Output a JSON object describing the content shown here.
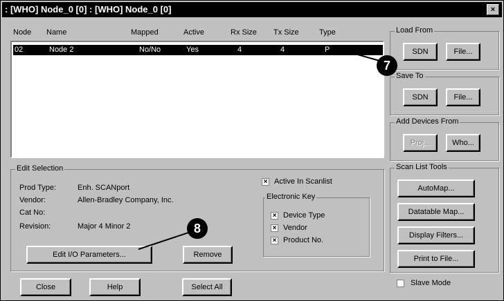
{
  "window": {
    "title": ": [WHO] Node_0 [0] : [WHO] Node_0 [0]",
    "close": "×"
  },
  "columns": [
    "Node",
    "Name",
    "Mapped",
    "Active",
    "Rx Size",
    "Tx Size",
    "Type"
  ],
  "rows": [
    {
      "node": "02",
      "name": "Node 2",
      "mapped": "No/No",
      "active": "Yes",
      "rx": "4",
      "tx": "4",
      "type": "P"
    }
  ],
  "load_from": {
    "title": "Load From",
    "sdn": "SDN",
    "file": "File..."
  },
  "save_to": {
    "title": "Save To",
    "sdn": "SDN",
    "file": "File..."
  },
  "add_devices": {
    "title": "Add Devices From",
    "proj": "Proj...",
    "who": "Who..."
  },
  "edit_selection": {
    "title": "Edit Selection",
    "prod_type_label": "Prod Type:",
    "prod_type": "Enh. SCANport",
    "vendor_label": "Vendor:",
    "vendor": "Allen-Bradley Company, Inc.",
    "cat_label": "Cat No:",
    "cat": "",
    "revision_label": "Revision:",
    "revision": "Major 4 Minor 2",
    "edit_io": "Edit I/O Parameters...",
    "remove": "Remove"
  },
  "active_in_scanlist": "Active In Scanlist",
  "electronic_key": {
    "title": "Electronic Key",
    "device_type": "Device Type",
    "vendor": "Vendor",
    "product_no": "Product No."
  },
  "scan_tools": {
    "title": "Scan List Tools",
    "automap": "AutoMap...",
    "datatable": "Datatable Map...",
    "display_filters": "Display Filters...",
    "print": "Print to File..."
  },
  "slave_mode": "Slave Mode",
  "bottom": {
    "close": "Close",
    "help": "Help",
    "select_all": "Select All"
  },
  "callouts": [
    "7",
    "8"
  ]
}
